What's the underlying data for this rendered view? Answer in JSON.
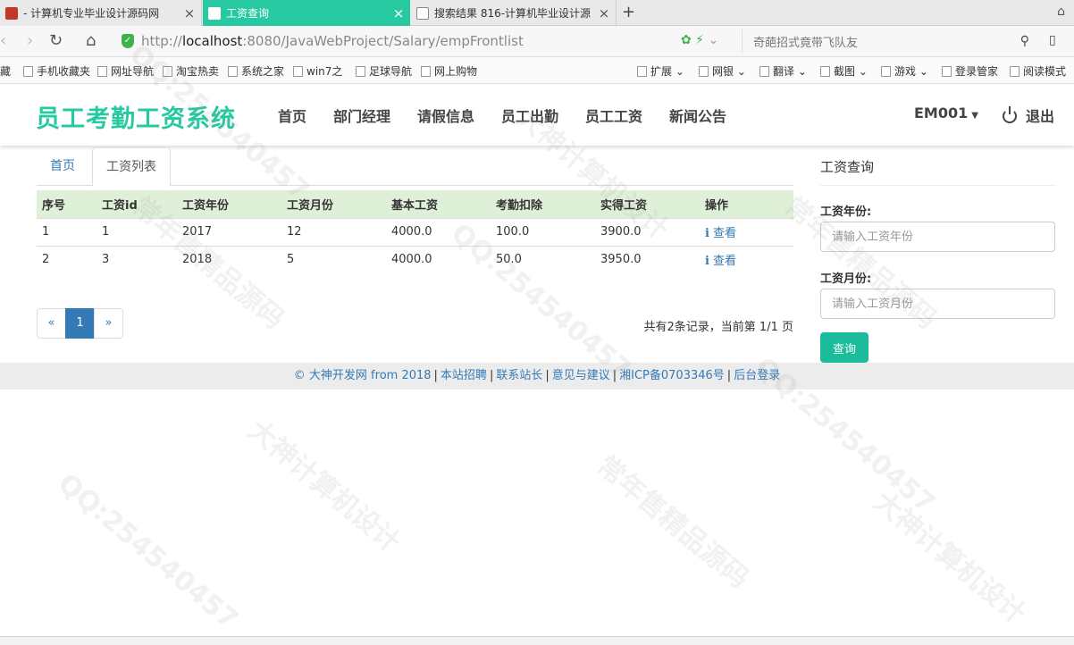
{
  "browser": {
    "tabs": [
      {
        "title": " - 计算机专业毕业设计源码网",
        "active": false
      },
      {
        "title": "工资查询",
        "active": true
      },
      {
        "title": "搜索结果 816-计算机毕业设计源",
        "active": false
      }
    ],
    "new_tab": "+",
    "url_prefix": "http://",
    "url_host": "localhost",
    "url_rest": ":8080/JavaWebProject/Salary/empFrontlist",
    "search_placeholder": "奇葩招式竟带飞队友",
    "bookmarks": [
      "手机收藏夹",
      "网址导航",
      "淘宝热卖",
      "系统之家",
      "win7之",
      "足球导航",
      "网上购物",
      "扩展",
      "网银",
      "翻译",
      "截图",
      "游戏",
      "登录管家",
      "阅读模式"
    ]
  },
  "navbar": {
    "brand": "员工考勤工资系统",
    "items": [
      "首页",
      "部门经理",
      "请假信息",
      "员工出勤",
      "员工工资",
      "新闻公告"
    ],
    "user": "EM001",
    "logout": "退出"
  },
  "subtabs": [
    "首页",
    "工资列表"
  ],
  "table": {
    "headers": [
      "序号",
      "工资id",
      "工资年份",
      "工资月份",
      "基本工资",
      "考勤扣除",
      "实得工资",
      "操作"
    ],
    "rows": [
      {
        "seq": "1",
        "id": "1",
        "year": "2017",
        "month": "12",
        "base": "4000.0",
        "deduct": "100.0",
        "net": "3900.0",
        "action": "查看"
      },
      {
        "seq": "2",
        "id": "3",
        "year": "2018",
        "month": "5",
        "base": "4000.0",
        "deduct": "50.0",
        "net": "3950.0",
        "action": "查看"
      }
    ]
  },
  "pagination": {
    "prev": "«",
    "current": "1",
    "next": "»",
    "summary": "共有2条记录，当前第 1/1 页"
  },
  "search_panel": {
    "title": "工资查询",
    "year_label": "工资年份:",
    "year_placeholder": "请输入工资年份",
    "month_label": "工资月份:",
    "month_placeholder": "请输入工资月份",
    "submit": "查询"
  },
  "footer": {
    "links": [
      "© 大神开发网 from 2018",
      "本站招聘",
      "联系站长",
      "意见与建议",
      "湘ICP备0703346号",
      "后台登录"
    ]
  },
  "watermarks": [
    "QQ:254540457",
    "大神计算机设计",
    "常年售精品源码"
  ],
  "colors": {
    "accent": "#27c9a0",
    "link": "#337ab7",
    "table_header": "#dff0d8",
    "button": "#1abc9c"
  }
}
